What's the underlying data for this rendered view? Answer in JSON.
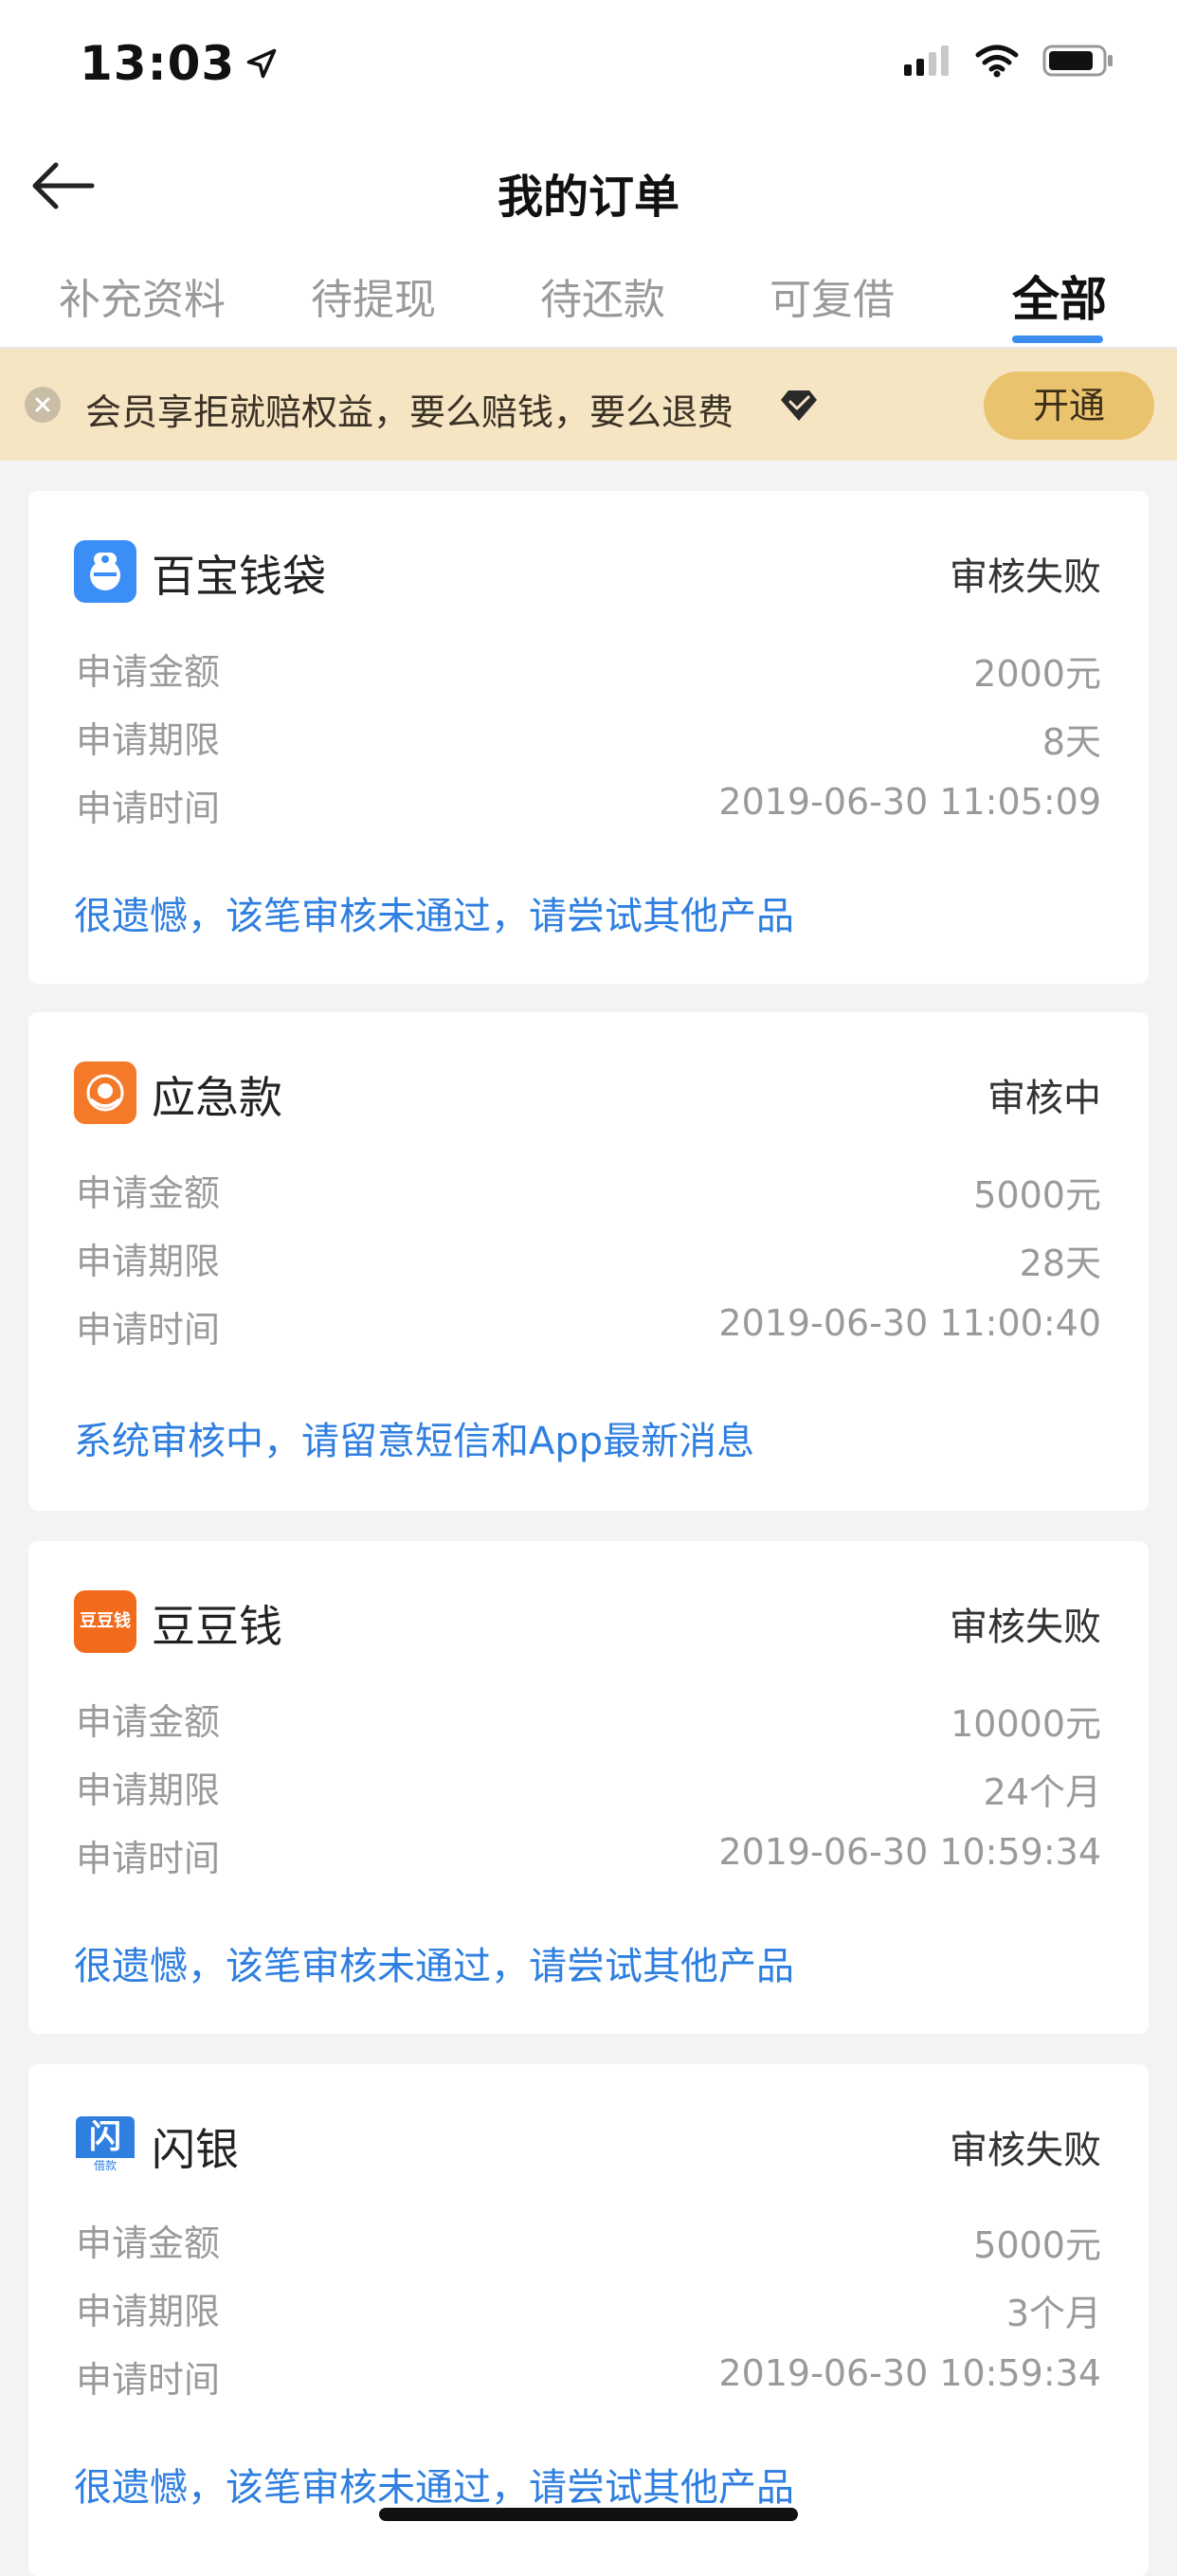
{
  "status_bar": {
    "time": "13:03"
  },
  "nav": {
    "title": "我的订单"
  },
  "tabs": [
    {
      "label": "补充资料"
    },
    {
      "label": "待提现"
    },
    {
      "label": "待还款"
    },
    {
      "label": "可复借"
    },
    {
      "label": "全部"
    }
  ],
  "banner": {
    "text": "会员享拒就赔权益，要么赔钱，要么退费",
    "button": "开通"
  },
  "labels": {
    "amount": "申请金额",
    "term": "申请期限",
    "time": "申请时间"
  },
  "orders": [
    {
      "name": "百宝钱袋",
      "status": "审核失败",
      "amount": "2000元",
      "term": "8天",
      "time": "2019-06-30 11:05:09",
      "message": "很遗憾，该笔审核未通过，请尝试其他产品",
      "logo_color": "#3a8ef6"
    },
    {
      "name": "应急款",
      "status": "审核中",
      "amount": "5000元",
      "term": "28天",
      "time": "2019-06-30 11:00:40",
      "message": "系统审核中，请留意短信和App最新消息",
      "logo_color": "#f47a2a"
    },
    {
      "name": "豆豆钱",
      "status": "审核失败",
      "amount": "10000元",
      "term": "24个月",
      "time": "2019-06-30 10:59:34",
      "message": "很遗憾，该笔审核未通过，请尝试其他产品",
      "logo_color": "#f26a1b",
      "logo_text": "豆豆钱"
    },
    {
      "name": "闪银",
      "status": "审核失败",
      "amount": "5000元",
      "term": "3个月",
      "time": "2019-06-30 10:59:34",
      "message": "很遗憾，该笔审核未通过，请尝试其他产品",
      "logo_color": "#2f7fe1",
      "logo_text": "闪",
      "logo_subtext": "借款"
    }
  ],
  "colors": {
    "accent": "#3b8ef0",
    "link": "#2f7fe1",
    "banner_bg": "#f6e5c3",
    "banner_button": "#eac36e"
  }
}
